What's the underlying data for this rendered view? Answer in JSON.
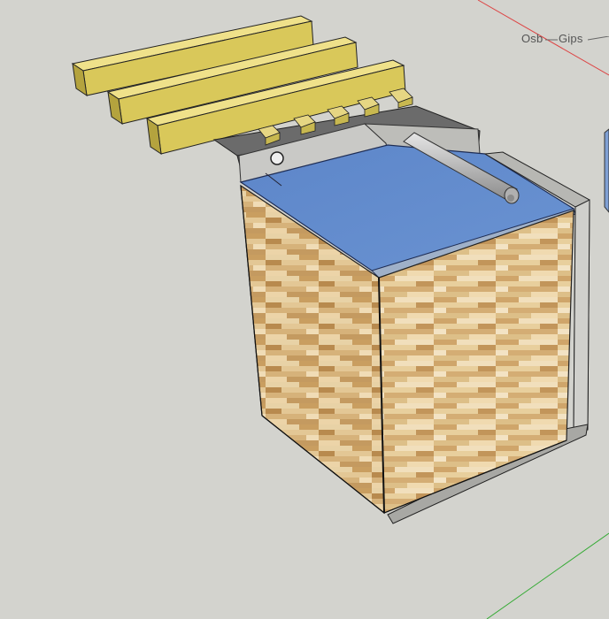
{
  "scene": {
    "background_color": "#d3d3ce",
    "axis_colors": {
      "red": "#d33",
      "green": "#3a3"
    },
    "tags": [
      {
        "id": "osb",
        "text": "Osb"
      },
      {
        "id": "gips",
        "text": "Gips"
      }
    ],
    "materials": {
      "wood_planks": "#dcc85e",
      "plank_edge": "#9e8b2a",
      "sheet_blue": "#5b86c8",
      "panel_grey": "#b8b8b4",
      "wood_light": "#e0c594",
      "wood_dark": "#c79f66"
    }
  }
}
